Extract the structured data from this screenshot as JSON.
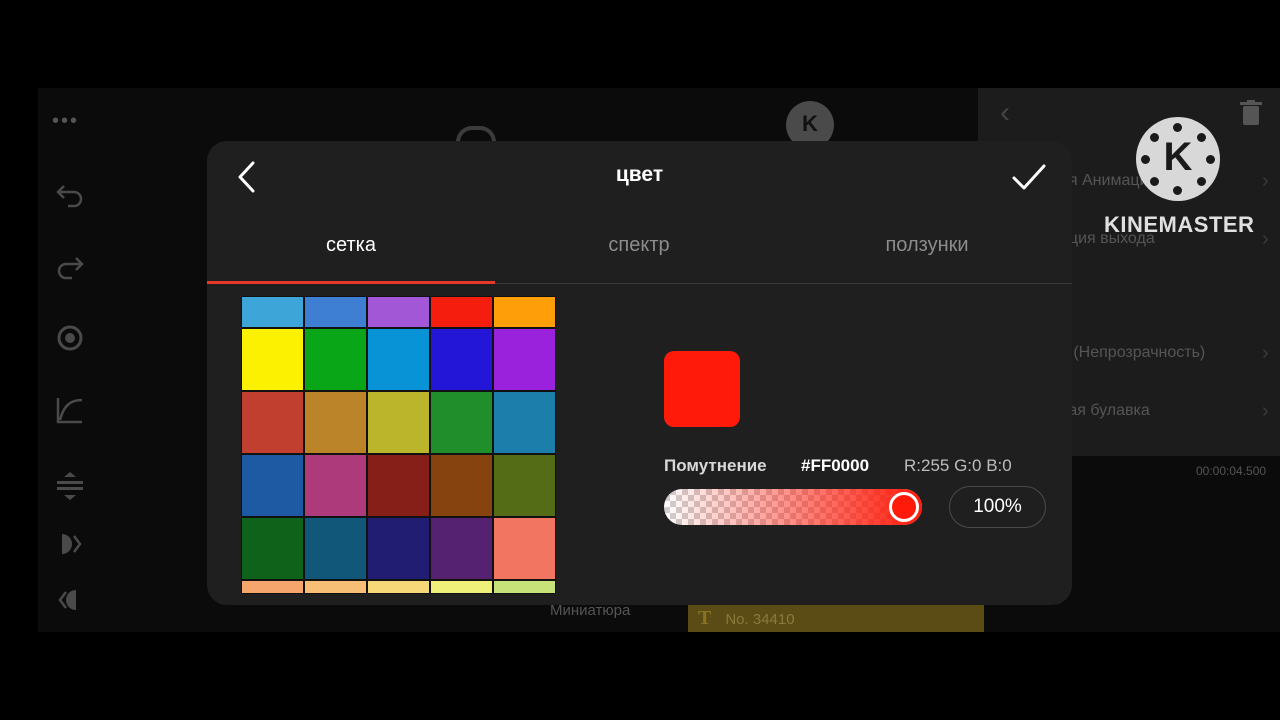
{
  "background": {
    "panel_items": [
      {
        "label": "ая Анимация"
      },
      {
        "label": "ация выхода"
      },
      {
        "label": "а (Непрозрачность)"
      },
      {
        "label": "вая булавка"
      }
    ],
    "timestamp": "00:00:04.500",
    "thumbnail_label": "Миниатюра",
    "clip_text": "No. 34410",
    "clip_type_glyph": "T",
    "logo_letter": "K"
  },
  "watermark": {
    "logo_letter": "K",
    "brand": "KINEMASTER"
  },
  "dialog": {
    "title": "цвет",
    "tabs": [
      {
        "label": "сетка",
        "active": true
      },
      {
        "label": "спектр",
        "active": false
      },
      {
        "label": "ползунки",
        "active": false
      }
    ],
    "grid_colors": [
      [
        "#3ea5d8",
        "#3f7fd3",
        "#a257d7",
        "#f51d0e",
        "#fe9e09"
      ],
      [
        "#fcf100",
        "#09a717",
        "#0893d6",
        "#2416d6",
        "#9a22dc"
      ],
      [
        "#c03f2f",
        "#bb8428",
        "#bab52b",
        "#208f2b",
        "#1c7eab"
      ],
      [
        "#1e5aa4",
        "#ad3a7b",
        "#861f17",
        "#864310",
        "#546c15"
      ],
      [
        "#0f6219",
        "#11577a",
        "#211d72",
        "#552272",
        "#f17560"
      ],
      [
        "#f6a56c",
        "#f6bf75",
        "#f6d878",
        "#eef07a",
        "#c8e27a"
      ]
    ],
    "selected": {
      "color": "#ff1a0a",
      "opacity_label": "Помутнение",
      "hex": "#FF0000",
      "rgb": "R:255 G:0 B:0",
      "opacity_percent": 100,
      "opacity_text": "100%"
    },
    "accent_color": "#e8382c",
    "icons": {
      "back": "chevron-left-icon",
      "confirm": "checkmark-icon"
    }
  }
}
